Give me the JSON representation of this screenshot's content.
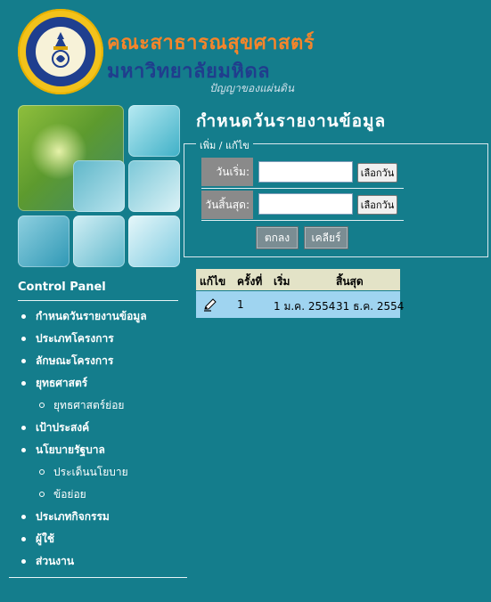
{
  "header": {
    "faculty": "คณะสาธารณสุขศาสตร์",
    "university": "มหาวิทยาลัยมหิดล",
    "motto": "ปัญญาของแผ่นดิน"
  },
  "sidebar": {
    "title": "Control Panel",
    "items": [
      {
        "label": "กำหนดวันรายงานข้อมูล",
        "level": 1
      },
      {
        "label": "ประเภทโครงการ",
        "level": 1
      },
      {
        "label": "ลักษณะโครงการ",
        "level": 1
      },
      {
        "label": "ยุทธศาสตร์",
        "level": 1
      },
      {
        "label": "ยุทธศาสตร์ย่อย",
        "level": 2
      },
      {
        "label": "เป้าประสงค์",
        "level": 1
      },
      {
        "label": "นโยบายรัฐบาล",
        "level": 1
      },
      {
        "label": "ประเด็นนโยบาย",
        "level": 2
      },
      {
        "label": "ข้อย่อย",
        "level": 2
      },
      {
        "label": "ประเภทกิจกรรม",
        "level": 1
      },
      {
        "label": "ผู้ใช้",
        "level": 1
      },
      {
        "label": "ส่วนงาน",
        "level": 1
      }
    ]
  },
  "main": {
    "title": "กำหนดวันรายงานข้อมูล",
    "form": {
      "legend": "เพิ่ม / แก้ไข",
      "start_label": "วันเริ่ม:",
      "start_value": "",
      "end_label": "วันสิ้นสุด:",
      "end_value": "",
      "pick_label": "เลือกวัน",
      "ok_label": "ตกลง",
      "clear_label": "เคลียร์"
    },
    "table": {
      "headers": [
        "แก้ไข",
        "ครั้งที่",
        "เริ่ม",
        "สิ้นสุด"
      ],
      "rows": [
        {
          "round": "1",
          "start": "1 ม.ค. 2554",
          "end": "31 ธ.ค. 2554"
        }
      ]
    }
  },
  "colors": {
    "background": "#147d8c",
    "faculty_text": "#f6852a",
    "university_text": "#203d8d",
    "table_header": "#e3e3c7",
    "table_row": "#9fd4f0"
  }
}
